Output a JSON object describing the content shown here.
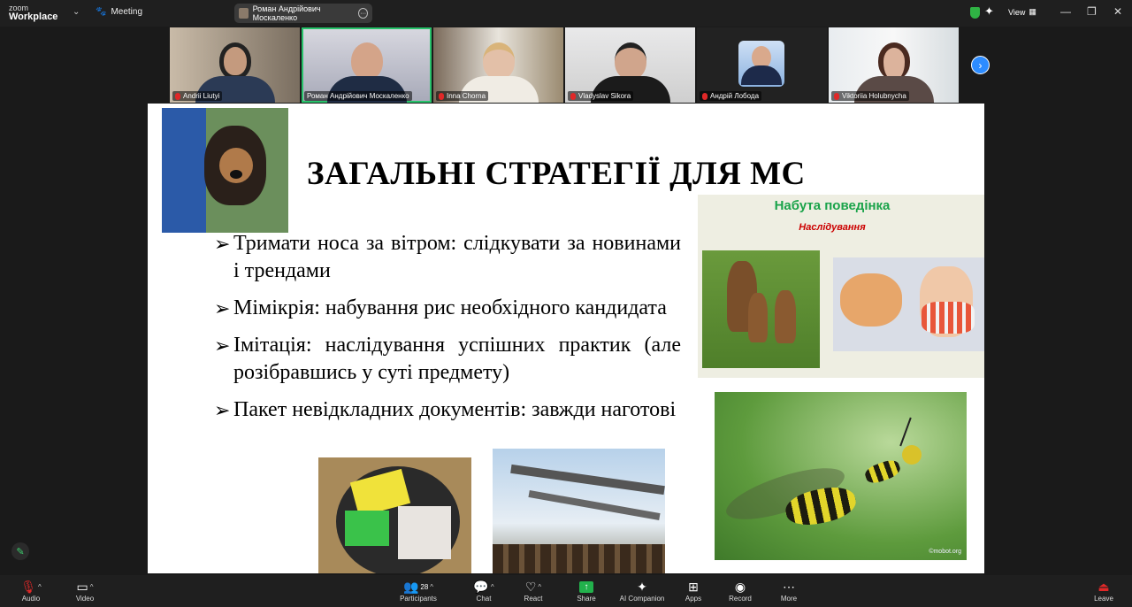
{
  "app": {
    "brand_top": "zoom",
    "brand_main": "Workplace",
    "meeting_label": "Meeting"
  },
  "active_speaker": {
    "name": "Роман Андрійович Москаленко"
  },
  "view_label": "View",
  "participants": [
    {
      "name": "Andrii Liutyi",
      "muted": true
    },
    {
      "name": "Роман Андрійович Москаленко",
      "muted": false,
      "active": true
    },
    {
      "name": "Inna Chorna",
      "muted": true
    },
    {
      "name": "Vladyslav Sikora",
      "muted": true
    },
    {
      "name": "Андрій Лобода",
      "muted": true
    },
    {
      "name": "Viktoriia Holubnycha",
      "muted": true
    }
  ],
  "slide": {
    "title": "ЗАГАЛЬНІ СТРАТЕГІЇ ДЛЯ МС",
    "bullets": [
      "Тримати носа за вітром: слідкувати за новинами і трендами",
      "Мімікрія: набування рис необхідного кандидата",
      "Імітація: наслідування успішних практик (але розібравшись у суті предмету)",
      "Пакет невідкладних документів: завжди наготові"
    ],
    "panel_title": "Набута поведінка",
    "panel_subtitle": "Наслідування",
    "photo_watermark": "©mobot.org"
  },
  "toolbar": {
    "audio": "Audio",
    "video": "Video",
    "participants": "Participants",
    "participants_count": "28",
    "chat": "Chat",
    "react": "React",
    "share": "Share",
    "ai_companion": "AI Companion",
    "apps": "Apps",
    "record": "Record",
    "more": "More",
    "leave": "Leave"
  },
  "colors": {
    "accent": "#2d8cff",
    "active_border": "#27c26a",
    "share_green": "#22b14c",
    "panel_title": "#1aa34a",
    "panel_sub": "#cc0000"
  }
}
